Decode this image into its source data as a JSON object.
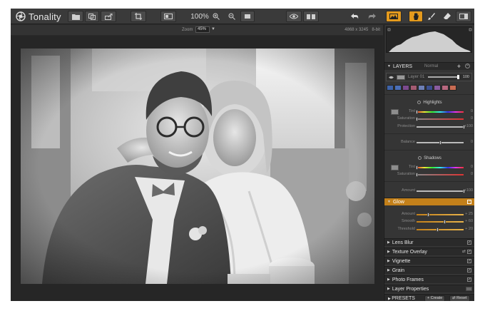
{
  "app": {
    "brand": "Tonality",
    "zoom_percent": "100%",
    "colors": {
      "accent": "#e49a1d",
      "glow_header": "#c3801a"
    }
  },
  "subbar": {
    "zoom_label": "Zoom",
    "zoom_value": "45%",
    "dimensions": "4868 x 3245",
    "bit_depth": "8-bit"
  },
  "layers": {
    "title": "LAYERS",
    "blend_mode": "Normal",
    "layer_name": "Layer 01",
    "opacity": "100",
    "opacity_fraction": 1.0,
    "swatches": [
      "#3e63a8",
      "#4a6fb8",
      "#7b4a8e",
      "#a35b72",
      "#6d7fb6",
      "#3b4f8e",
      "#8a5ca0",
      "#b7687f",
      "#c86b52"
    ]
  },
  "highlights": {
    "title": "Highlights",
    "tint_label": "Tint",
    "tint_value": "0",
    "tint_pos": 0.0,
    "saturation_label": "Saturation",
    "saturation_value": "0",
    "saturation_pos": 0.0,
    "protection_label": "Protection",
    "protection_value": "+100",
    "protection_pos": 1.0
  },
  "balance": {
    "label": "Balance",
    "value": "0",
    "pos": 0.5
  },
  "shadows": {
    "title": "Shadows",
    "tint_label": "Tint",
    "tint_value": "0",
    "tint_pos": 0.0,
    "saturation_label": "Saturation",
    "saturation_value": "0",
    "saturation_pos": 0.0
  },
  "amount": {
    "label": "Amount",
    "value": "+100",
    "pos": 1.0
  },
  "glow": {
    "title": "Glow",
    "amount_label": "Amount",
    "amount_value": "+ 25",
    "amount_pos": 0.25,
    "smooth_label": "Smooth",
    "smooth_value": "+ 60",
    "smooth_pos": 0.6,
    "threshold_label": "Threshold",
    "threshold_value": "+ 20",
    "threshold_pos": 0.45
  },
  "sections": [
    {
      "label": "Lens Blur"
    },
    {
      "label": "Texture Overlay"
    },
    {
      "label": "Vignette"
    },
    {
      "label": "Grain"
    },
    {
      "label": "Photo Frames"
    },
    {
      "label": "Layer Properties"
    }
  ],
  "presets": {
    "title": "PRESETS",
    "create_label": "Create",
    "reset_label": "Reset"
  }
}
